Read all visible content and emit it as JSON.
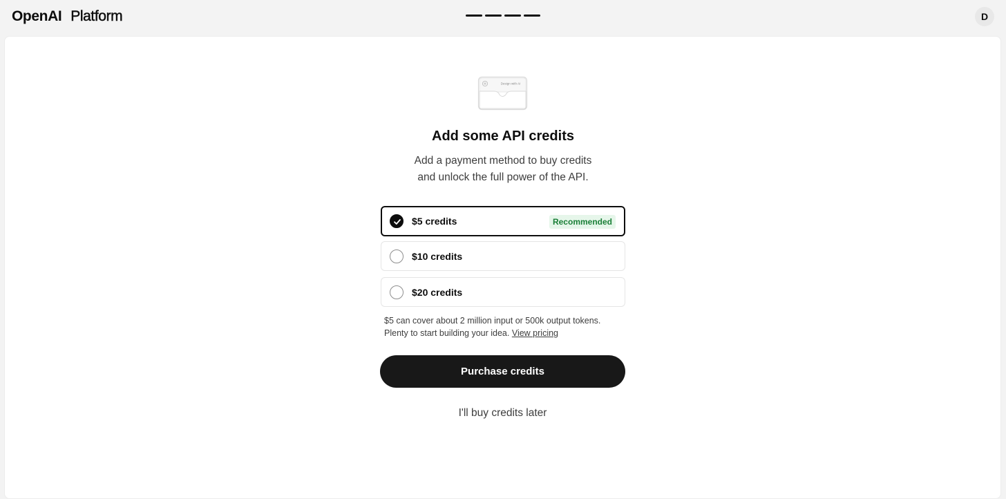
{
  "header": {
    "brand_name": "OpenAI",
    "product_name": "Platform",
    "progress_steps": 4,
    "user_initial": "D"
  },
  "illustration": {
    "card_text": "Design with AI"
  },
  "main": {
    "title": "Add some API credits",
    "subtitle_line1": "Add a payment method to buy credits",
    "subtitle_line2": "and unlock the full power of the API."
  },
  "options": [
    {
      "label": "$5 credits",
      "selected": true,
      "badge": "Recommended"
    },
    {
      "label": "$10 credits",
      "selected": false
    },
    {
      "label": "$20 credits",
      "selected": false
    }
  ],
  "note": {
    "line1": "$5 can cover about 2 million input or 500k output tokens.",
    "line2": "Plenty to start building your idea.",
    "link": "View pricing"
  },
  "actions": {
    "purchase_label": "Purchase credits",
    "later_label": "I'll buy credits later"
  },
  "colors": {
    "accent": "#0d0d0d",
    "badge_bg": "#e6f6ea",
    "badge_text": "#1a7f37",
    "page_bg": "#f3f3f3"
  }
}
